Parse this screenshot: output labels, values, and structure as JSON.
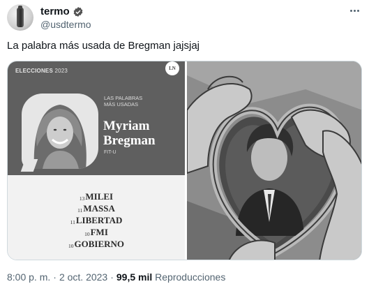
{
  "tweet": {
    "display_name": "termo",
    "handle": "@usdtermo",
    "text": "La palabra más usada de Bregman jajsjaj",
    "time": "8:00 p. m.",
    "date": "2 oct. 2023",
    "views": "99,5 mil",
    "views_label": "Reproducciones",
    "separator": "·"
  },
  "card": {
    "section": "ELECCIONES",
    "year": "2023",
    "logo": "LN",
    "subtitle": "LAS PALABRAS\nMÁS USADAS",
    "name": "Myriam\nBregman",
    "party": "FIT-U",
    "words": [
      {
        "count": "13",
        "word": "MILEI"
      },
      {
        "count": "11",
        "word": "MASSA"
      },
      {
        "count": "11",
        "word": "LIBERTAD"
      },
      {
        "count": "10",
        "word": "FMI"
      },
      {
        "count": "10",
        "word": "GOBIERNO"
      }
    ]
  },
  "icons": {
    "verified": "verified-badge-icon",
    "more": "more-options-icon"
  },
  "colors": {
    "text_primary": "#0f1419",
    "text_secondary": "#536471",
    "border": "#cfd9de"
  }
}
